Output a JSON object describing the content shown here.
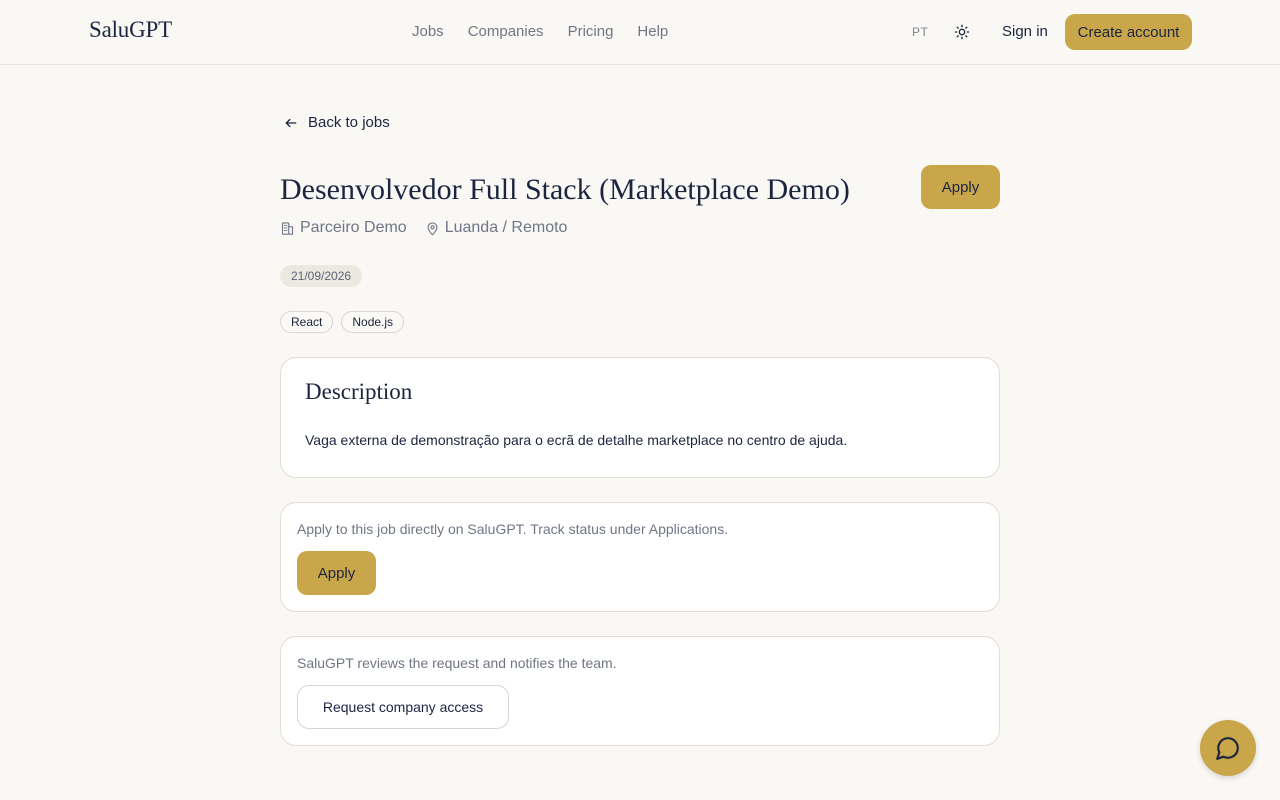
{
  "header": {
    "logo": "SaluGPT",
    "nav": [
      {
        "label": "Jobs"
      },
      {
        "label": "Companies"
      },
      {
        "label": "Pricing"
      },
      {
        "label": "Help"
      }
    ],
    "lang": "PT",
    "theme_icon": "sun-icon",
    "sign_in": "Sign in",
    "create_account": "Create account"
  },
  "back": {
    "icon": "arrow-left-icon",
    "label": "Back to jobs"
  },
  "job": {
    "title": "Desenvolvedor Full Stack (Marketplace Demo)",
    "apply_label": "Apply",
    "company_icon": "building-icon",
    "company": "Parceiro Demo",
    "location_icon": "map-pin-icon",
    "location": "Luanda / Remoto",
    "date": "21/09/2026",
    "tags": [
      "React",
      "Node.js"
    ]
  },
  "description": {
    "heading": "Description",
    "text": "Vaga externa de demonstração para o ecrã de detalhe marketplace no centro de ajuda."
  },
  "apply_card": {
    "text": "Apply to this job directly on SaluGPT. Track status under Applications.",
    "button": "Apply"
  },
  "access_card": {
    "text": "SaluGPT reviews the request and notifies the team.",
    "button": "Request company access"
  },
  "chat": {
    "icon": "chat-bubble-icon"
  },
  "colors": {
    "accent": "#c9a64a",
    "text": "#1c2440",
    "muted": "#707686",
    "background": "#f9f8f4"
  }
}
